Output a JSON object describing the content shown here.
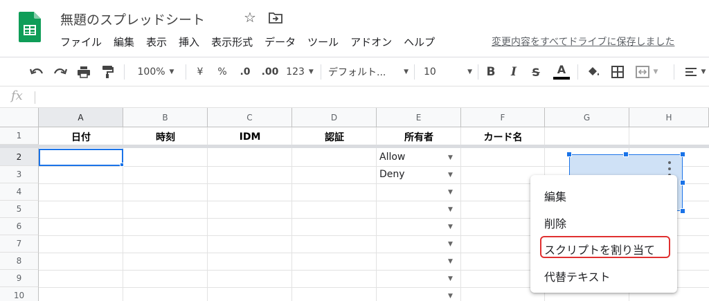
{
  "header": {
    "title": "無題のスプレッドシート",
    "save_status": "変更内容をすべてドライブに保存しました"
  },
  "menu": [
    "ファイル",
    "編集",
    "表示",
    "挿入",
    "表示形式",
    "データ",
    "ツール",
    "アドオン",
    "ヘルプ"
  ],
  "toolbar": {
    "zoom": "100%",
    "currency": "¥",
    "percent": "%",
    "decrease_decimal": ".0",
    "increase_decimal": ".00",
    "more_formats": "123",
    "font": "デフォルト...",
    "font_size": "10"
  },
  "formula_bar": {
    "fx": "fx"
  },
  "grid": {
    "columns": [
      "A",
      "B",
      "C",
      "D",
      "E",
      "F",
      "G",
      "H"
    ],
    "rows": [
      "1",
      "2",
      "3",
      "4",
      "5",
      "6",
      "7",
      "8",
      "9",
      "10"
    ],
    "header_row": [
      "日付",
      "時刻",
      "IDM",
      "認証",
      "所有者",
      "カード名"
    ],
    "dropdown_values": [
      "Allow",
      "Deny"
    ]
  },
  "context_menu": {
    "items": [
      "編集",
      "削除",
      "スクリプトを割り当て",
      "代替テキスト"
    ]
  },
  "colors": {
    "accent": "#1a73e8",
    "highlight": "#e03030",
    "sheets_green": "#0f9d58"
  }
}
